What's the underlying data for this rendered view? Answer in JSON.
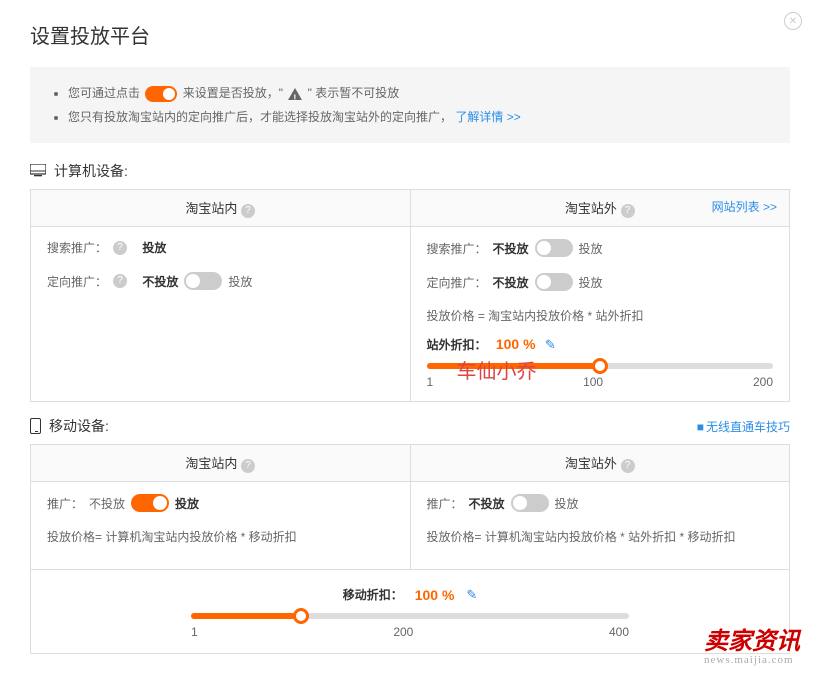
{
  "title": "设置投放平台",
  "notice": {
    "line1_a": "您可通过点击",
    "line1_b": "来设置是否投放，\"",
    "line1_c": "\" 表示暂不可投放",
    "line2_a": "您只有投放淘宝站内的定向推广后，才能选择投放淘宝站外的定向推广，",
    "line2_link": "了解详情 >>"
  },
  "labels": {
    "computer": "计算机设备:",
    "mobile": "移动设备:",
    "taobao_in": "淘宝站内",
    "taobao_out": "淘宝站外",
    "site_list": "网站列表 >>",
    "search_promo": "搜索推广：",
    "direct_promo": "定向推广：",
    "promo": "推广：",
    "put": "投放",
    "noput": "不投放",
    "out_discount": "站外折扣：",
    "mobile_discount": "移动折扣：",
    "wireless_tips": "无线直通车技巧"
  },
  "computer": {
    "in": {
      "search_put": "投放",
      "direct_put_pref": "不投放",
      "direct_put_suf": "投放"
    },
    "out": {
      "search_pref": "不投放",
      "search_suf": "投放",
      "direct_pref": "不投放",
      "direct_suf": "投放",
      "formula": "投放价格 = 淘宝站内投放价格 * 站外折扣",
      "discount": "100 %",
      "slider": {
        "min": "1",
        "mid": "100",
        "max": "200",
        "fill_pct": 50
      }
    }
  },
  "mobile": {
    "in": {
      "pref": "不投放",
      "suf": "投放",
      "formula": "投放价格= 计算机淘宝站内投放价格 * 移动折扣"
    },
    "out": {
      "pref": "不投放",
      "suf": "投放",
      "formula": "投放价格= 计算机淘宝站内投放价格 * 站外折扣 * 移动折扣"
    },
    "discount": "100 %",
    "slider": {
      "min": "1",
      "mid": "200",
      "max": "400",
      "fill_pct": 25
    }
  },
  "watermark1": "车仙小乔",
  "watermark2": {
    "l1": "卖家资讯",
    "l2": "news.maijia.com"
  }
}
